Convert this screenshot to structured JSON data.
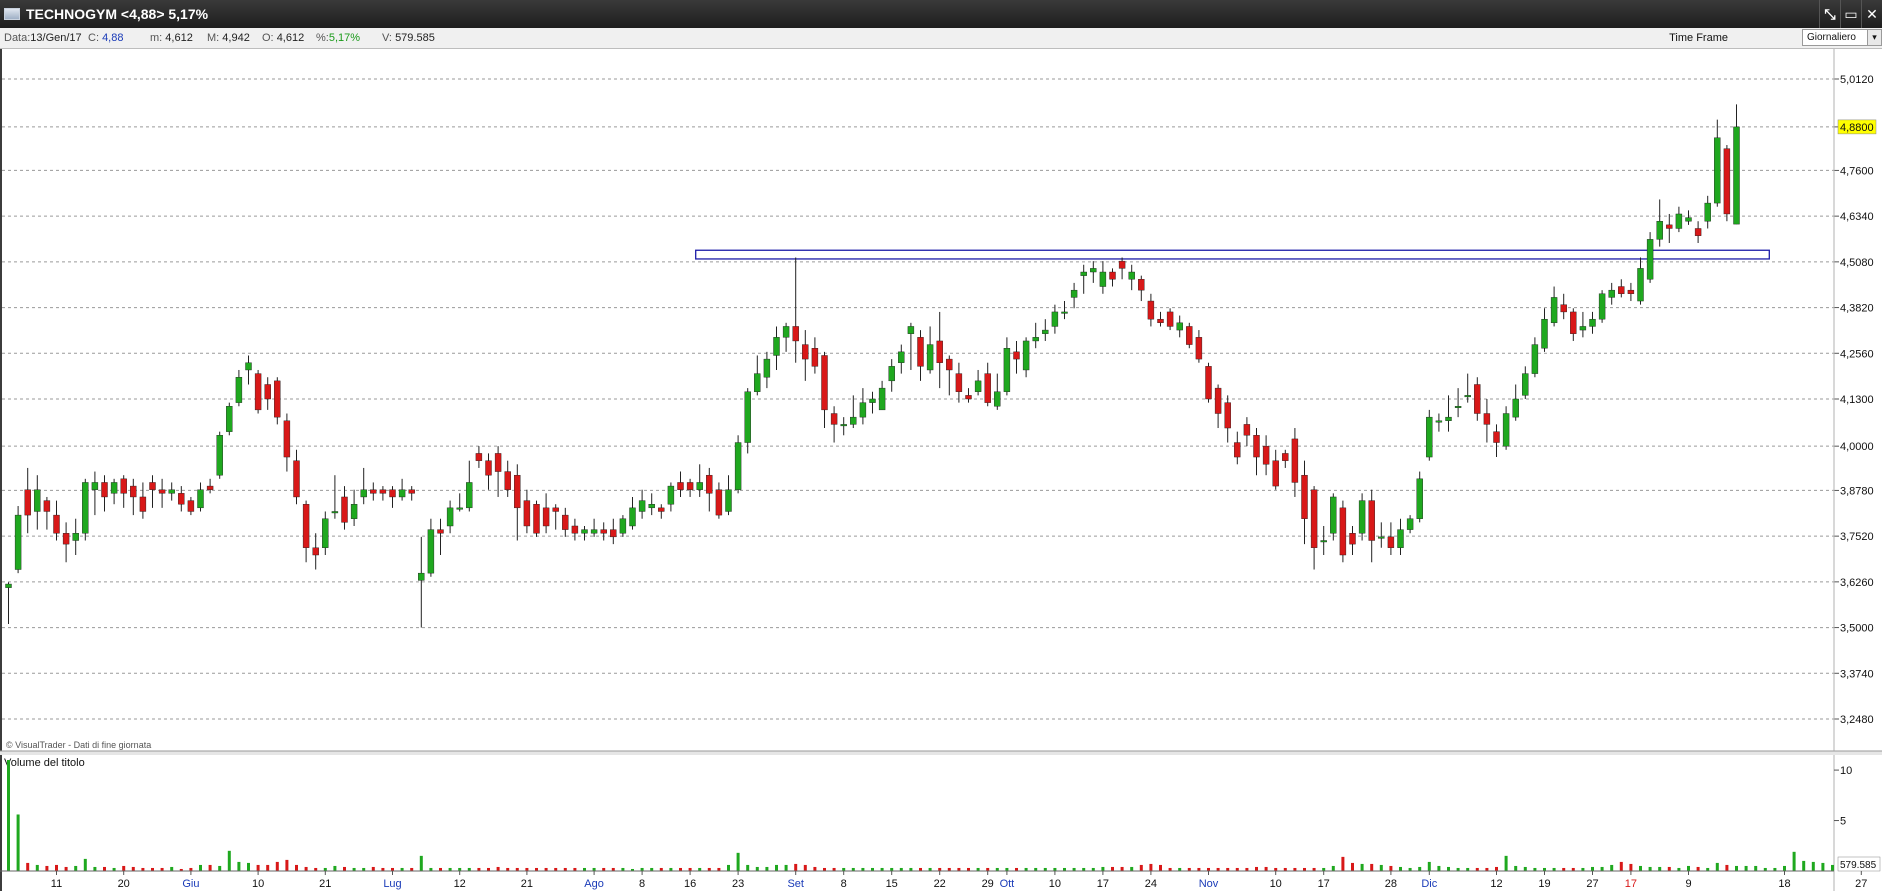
{
  "window": {
    "title": "TECHNOGYM <4,88> 5,17%",
    "controls": [
      "⤡",
      "▭",
      "✕"
    ]
  },
  "infobar": {
    "data_label": "Data:",
    "data_value": "13/Gen/17",
    "c_label": "C:",
    "c_value": "4,88",
    "min_label": "m:",
    "min_value": "4,612",
    "max_label": "M:",
    "max_value": "4,942",
    "o_label": "O:",
    "o_value": "4,612",
    "pct_label": "%:",
    "pct_value": "5,17%",
    "v_label": "V:",
    "v_value": "579.585",
    "timeframe_label": "Time Frame",
    "timeframe_value": "Giornaliero"
  },
  "colors": {
    "up": "#1fa81f",
    "down": "#d81818",
    "grid": "#9a9a9a",
    "rect": "#1c1ca8",
    "last_price_bg": "#ffff00"
  },
  "chart_data": {
    "type": "candlestick",
    "price_axis": {
      "ticks": [
        "5,0120",
        "4,8800",
        "4,7600",
        "4,6340",
        "4,5080",
        "4,3820",
        "4,2560",
        "4,1300",
        "4,0000",
        "3,8780",
        "3,7520",
        "3,6260",
        "3,5000",
        "3,3740",
        "3,2480"
      ],
      "ylim": [
        3.2,
        5.06
      ],
      "last_price": "4,8800"
    },
    "x_axis_labels": [
      {
        "label": "11",
        "idx": 5,
        "month": false
      },
      {
        "label": "20",
        "idx": 12,
        "month": false
      },
      {
        "label": "Giu",
        "idx": 19,
        "month": true
      },
      {
        "label": "10",
        "idx": 26,
        "month": false
      },
      {
        "label": "21",
        "idx": 33,
        "month": false
      },
      {
        "label": "Lug",
        "idx": 40,
        "month": true
      },
      {
        "label": "12",
        "idx": 47,
        "month": false
      },
      {
        "label": "21",
        "idx": 54,
        "month": false
      },
      {
        "label": "Ago",
        "idx": 61,
        "month": true
      },
      {
        "label": "8",
        "idx": 66,
        "month": false
      },
      {
        "label": "16",
        "idx": 71,
        "month": false
      },
      {
        "label": "23",
        "idx": 76,
        "month": false
      },
      {
        "label": "Set",
        "idx": 82,
        "month": true
      },
      {
        "label": "8",
        "idx": 87,
        "month": false
      },
      {
        "label": "15",
        "idx": 92,
        "month": false
      },
      {
        "label": "22",
        "idx": 97,
        "month": false
      },
      {
        "label": "29",
        "idx": 102,
        "month": false
      },
      {
        "label": "Ott",
        "idx": 104,
        "month": true
      },
      {
        "label": "10",
        "idx": 109,
        "month": false
      },
      {
        "label": "17",
        "idx": 114,
        "month": false
      },
      {
        "label": "24",
        "idx": 119,
        "month": false
      },
      {
        "label": "Nov",
        "idx": 125,
        "month": true
      },
      {
        "label": "10",
        "idx": 132,
        "month": false
      },
      {
        "label": "17",
        "idx": 137,
        "month": false
      },
      {
        "label": "28",
        "idx": 144,
        "month": false
      },
      {
        "label": "Dic",
        "idx": 148,
        "month": true
      },
      {
        "label": "12",
        "idx": 155,
        "month": false
      },
      {
        "label": "19",
        "idx": 160,
        "month": false
      },
      {
        "label": "27",
        "idx": 165,
        "month": false
      },
      {
        "label": "17",
        "idx": 169,
        "month": true
      },
      {
        "label": "9",
        "idx": 175,
        "month": false
      },
      {
        "label": "18",
        "idx": 185,
        "month": false
      },
      {
        "label": "27",
        "idx": 193,
        "month": false
      }
    ],
    "horizontal_level": {
      "price": 4.54,
      "low": 4.516,
      "from_idx": 72,
      "to_idx": 183
    },
    "candles": [
      [
        3.61,
        3.62,
        3.51,
        3.625
      ],
      [
        3.66,
        3.81,
        3.65,
        3.835
      ],
      [
        3.88,
        3.81,
        3.76,
        3.94
      ],
      [
        3.82,
        3.88,
        3.77,
        3.92
      ],
      [
        3.85,
        3.82,
        3.77,
        3.86
      ],
      [
        3.81,
        3.76,
        3.74,
        3.85
      ],
      [
        3.76,
        3.73,
        3.68,
        3.79
      ],
      [
        3.74,
        3.76,
        3.7,
        3.8
      ],
      [
        3.76,
        3.9,
        3.74,
        3.91
      ],
      [
        3.88,
        3.9,
        3.81,
        3.93
      ],
      [
        3.9,
        3.86,
        3.82,
        3.92
      ],
      [
        3.87,
        3.9,
        3.84,
        3.91
      ],
      [
        3.91,
        3.87,
        3.83,
        3.92
      ],
      [
        3.89,
        3.86,
        3.81,
        3.91
      ],
      [
        3.86,
        3.82,
        3.8,
        3.9
      ],
      [
        3.9,
        3.88,
        3.83,
        3.92
      ],
      [
        3.88,
        3.87,
        3.83,
        3.91
      ],
      [
        3.87,
        3.88,
        3.85,
        3.9
      ],
      [
        3.87,
        3.84,
        3.82,
        3.89
      ],
      [
        3.85,
        3.82,
        3.81,
        3.86
      ],
      [
        3.83,
        3.88,
        3.82,
        3.9
      ],
      [
        3.89,
        3.88,
        3.87,
        3.91
      ],
      [
        3.92,
        4.03,
        3.91,
        4.04
      ],
      [
        4.04,
        4.11,
        4.03,
        4.12
      ],
      [
        4.12,
        4.19,
        4.11,
        4.21
      ],
      [
        4.21,
        4.23,
        4.17,
        4.25
      ],
      [
        4.2,
        4.1,
        4.09,
        4.21
      ],
      [
        4.17,
        4.13,
        4.1,
        4.19
      ],
      [
        4.18,
        4.08,
        4.06,
        4.19
      ],
      [
        4.07,
        3.97,
        3.93,
        4.09
      ],
      [
        3.96,
        3.86,
        3.84,
        3.99
      ],
      [
        3.84,
        3.72,
        3.68,
        3.85
      ],
      [
        3.72,
        3.7,
        3.66,
        3.76
      ],
      [
        3.72,
        3.8,
        3.7,
        3.82
      ],
      [
        3.82,
        3.82,
        3.8,
        3.92
      ],
      [
        3.86,
        3.79,
        3.77,
        3.89
      ],
      [
        3.8,
        3.84,
        3.78,
        3.88
      ],
      [
        3.86,
        3.88,
        3.84,
        3.94
      ],
      [
        3.88,
        3.87,
        3.85,
        3.9
      ],
      [
        3.88,
        3.87,
        3.85,
        3.89
      ],
      [
        3.88,
        3.86,
        3.83,
        3.89
      ],
      [
        3.86,
        3.88,
        3.85,
        3.91
      ],
      [
        3.88,
        3.87,
        3.85,
        3.89
      ],
      [
        3.63,
        3.65,
        3.5,
        3.75
      ],
      [
        3.65,
        3.77,
        3.64,
        3.8
      ],
      [
        3.77,
        3.76,
        3.7,
        3.8
      ],
      [
        3.78,
        3.83,
        3.76,
        3.85
      ],
      [
        3.83,
        3.83,
        3.82,
        3.87
      ],
      [
        3.83,
        3.9,
        3.82,
        3.96
      ],
      [
        3.98,
        3.96,
        3.94,
        4.0
      ],
      [
        3.96,
        3.92,
        3.88,
        3.98
      ],
      [
        3.98,
        3.93,
        3.86,
        4.0
      ],
      [
        3.93,
        3.88,
        3.86,
        3.96
      ],
      [
        3.92,
        3.83,
        3.74,
        3.95
      ],
      [
        3.85,
        3.78,
        3.76,
        3.88
      ],
      [
        3.84,
        3.76,
        3.75,
        3.85
      ],
      [
        3.83,
        3.78,
        3.76,
        3.87
      ],
      [
        3.83,
        3.82,
        3.77,
        3.84
      ],
      [
        3.81,
        3.77,
        3.75,
        3.83
      ],
      [
        3.78,
        3.76,
        3.74,
        3.8
      ],
      [
        3.76,
        3.77,
        3.74,
        3.78
      ],
      [
        3.76,
        3.77,
        3.75,
        3.8
      ],
      [
        3.77,
        3.76,
        3.74,
        3.79
      ],
      [
        3.77,
        3.75,
        3.73,
        3.8
      ],
      [
        3.76,
        3.8,
        3.75,
        3.81
      ],
      [
        3.78,
        3.83,
        3.77,
        3.86
      ],
      [
        3.82,
        3.85,
        3.8,
        3.88
      ],
      [
        3.83,
        3.84,
        3.81,
        3.87
      ],
      [
        3.83,
        3.82,
        3.8,
        3.84
      ],
      [
        3.84,
        3.89,
        3.82,
        3.9
      ],
      [
        3.9,
        3.88,
        3.86,
        3.93
      ],
      [
        3.9,
        3.88,
        3.86,
        3.91
      ],
      [
        3.88,
        3.9,
        3.86,
        3.95
      ],
      [
        3.92,
        3.87,
        3.82,
        3.94
      ],
      [
        3.88,
        3.81,
        3.8,
        3.9
      ],
      [
        3.82,
        3.88,
        3.81,
        3.92
      ],
      [
        3.88,
        4.01,
        3.87,
        4.03
      ],
      [
        4.01,
        4.15,
        3.98,
        4.16
      ],
      [
        4.15,
        4.2,
        4.14,
        4.25
      ],
      [
        4.19,
        4.24,
        4.16,
        4.26
      ],
      [
        4.25,
        4.3,
        4.21,
        4.33
      ],
      [
        4.3,
        4.33,
        4.26,
        4.34
      ],
      [
        4.33,
        4.29,
        4.23,
        4.52
      ],
      [
        4.28,
        4.24,
        4.18,
        4.32
      ],
      [
        4.27,
        4.22,
        4.2,
        4.3
      ],
      [
        4.25,
        4.1,
        4.05,
        4.26
      ],
      [
        4.09,
        4.06,
        4.01,
        4.11
      ],
      [
        4.06,
        4.06,
        4.03,
        4.08
      ],
      [
        4.06,
        4.08,
        4.05,
        4.14
      ],
      [
        4.08,
        4.12,
        4.06,
        4.16
      ],
      [
        4.12,
        4.13,
        4.09,
        4.15
      ],
      [
        4.1,
        4.16,
        4.1,
        4.18
      ],
      [
        4.18,
        4.22,
        4.15,
        4.24
      ],
      [
        4.23,
        4.26,
        4.2,
        4.28
      ],
      [
        4.31,
        4.33,
        4.21,
        4.34
      ],
      [
        4.3,
        4.22,
        4.18,
        4.32
      ],
      [
        4.21,
        4.28,
        4.2,
        4.33
      ],
      [
        4.29,
        4.23,
        4.16,
        4.37
      ],
      [
        4.24,
        4.21,
        4.14,
        4.25
      ],
      [
        4.2,
        4.15,
        4.12,
        4.23
      ],
      [
        4.14,
        4.13,
        4.12,
        4.16
      ],
      [
        4.15,
        4.18,
        4.14,
        4.21
      ],
      [
        4.2,
        4.12,
        4.11,
        4.23
      ],
      [
        4.11,
        4.15,
        4.1,
        4.2
      ],
      [
        4.15,
        4.27,
        4.14,
        4.3
      ],
      [
        4.26,
        4.24,
        4.2,
        4.29
      ],
      [
        4.21,
        4.29,
        4.19,
        4.3
      ],
      [
        4.29,
        4.3,
        4.27,
        4.34
      ],
      [
        4.31,
        4.32,
        4.29,
        4.35
      ],
      [
        4.33,
        4.37,
        4.31,
        4.39
      ],
      [
        4.37,
        4.37,
        4.35,
        4.4
      ],
      [
        4.41,
        4.43,
        4.38,
        4.45
      ],
      [
        4.47,
        4.48,
        4.42,
        4.5
      ],
      [
        4.48,
        4.49,
        4.45,
        4.51
      ],
      [
        4.44,
        4.48,
        4.42,
        4.51
      ],
      [
        4.48,
        4.46,
        4.44,
        4.49
      ],
      [
        4.51,
        4.49,
        4.46,
        4.52
      ],
      [
        4.46,
        4.48,
        4.43,
        4.5
      ],
      [
        4.46,
        4.43,
        4.4,
        4.47
      ],
      [
        4.4,
        4.35,
        4.33,
        4.42
      ],
      [
        4.35,
        4.34,
        4.33,
        4.37
      ],
      [
        4.37,
        4.33,
        4.32,
        4.38
      ],
      [
        4.32,
        4.34,
        4.3,
        4.36
      ],
      [
        4.33,
        4.28,
        4.27,
        4.34
      ],
      [
        4.3,
        4.24,
        4.23,
        4.32
      ],
      [
        4.22,
        4.13,
        4.12,
        4.23
      ],
      [
        4.16,
        4.09,
        4.05,
        4.17
      ],
      [
        4.12,
        4.05,
        4.01,
        4.14
      ],
      [
        4.01,
        3.97,
        3.95,
        4.04
      ],
      [
        4.06,
        4.03,
        4.0,
        4.08
      ],
      [
        4.03,
        3.97,
        3.92,
        4.05
      ],
      [
        4.0,
        3.95,
        3.92,
        4.03
      ],
      [
        3.96,
        3.89,
        3.88,
        3.99
      ],
      [
        3.98,
        3.96,
        3.94,
        3.99
      ],
      [
        4.02,
        3.9,
        3.86,
        4.05
      ],
      [
        3.92,
        3.8,
        3.73,
        3.96
      ],
      [
        3.88,
        3.72,
        3.66,
        3.89
      ],
      [
        3.74,
        3.74,
        3.7,
        3.78
      ],
      [
        3.76,
        3.86,
        3.74,
        3.87
      ],
      [
        3.83,
        3.7,
        3.68,
        3.85
      ],
      [
        3.76,
        3.73,
        3.7,
        3.78
      ],
      [
        3.76,
        3.85,
        3.74,
        3.87
      ],
      [
        3.85,
        3.74,
        3.68,
        3.88
      ],
      [
        3.75,
        3.75,
        3.72,
        3.79
      ],
      [
        3.75,
        3.72,
        3.7,
        3.79
      ],
      [
        3.72,
        3.77,
        3.7,
        3.8
      ],
      [
        3.77,
        3.8,
        3.76,
        3.81
      ],
      [
        3.8,
        3.91,
        3.79,
        3.93
      ],
      [
        3.97,
        4.08,
        3.96,
        4.1
      ],
      [
        4.07,
        4.07,
        4.04,
        4.09
      ],
      [
        4.07,
        4.08,
        4.04,
        4.14
      ],
      [
        4.11,
        4.11,
        4.08,
        4.16
      ],
      [
        4.14,
        4.14,
        4.12,
        4.2
      ],
      [
        4.17,
        4.09,
        4.07,
        4.19
      ],
      [
        4.09,
        4.06,
        4.01,
        4.13
      ],
      [
        4.04,
        4.01,
        3.97,
        4.06
      ],
      [
        4.0,
        4.09,
        3.99,
        4.11
      ],
      [
        4.08,
        4.13,
        4.07,
        4.17
      ],
      [
        4.14,
        4.2,
        4.13,
        4.22
      ],
      [
        4.2,
        4.28,
        4.19,
        4.3
      ],
      [
        4.27,
        4.35,
        4.26,
        4.38
      ],
      [
        4.34,
        4.41,
        4.33,
        4.44
      ],
      [
        4.39,
        4.37,
        4.35,
        4.42
      ],
      [
        4.37,
        4.31,
        4.29,
        4.38
      ],
      [
        4.32,
        4.33,
        4.3,
        4.37
      ],
      [
        4.33,
        4.35,
        4.31,
        4.37
      ],
      [
        4.35,
        4.42,
        4.34,
        4.43
      ],
      [
        4.41,
        4.43,
        4.39,
        4.45
      ],
      [
        4.44,
        4.42,
        4.41,
        4.46
      ],
      [
        4.43,
        4.42,
        4.4,
        4.45
      ],
      [
        4.4,
        4.49,
        4.39,
        4.52
      ],
      [
        4.46,
        4.57,
        4.45,
        4.59
      ],
      [
        4.57,
        4.62,
        4.55,
        4.68
      ],
      [
        4.61,
        4.6,
        4.56,
        4.64
      ],
      [
        4.6,
        4.64,
        4.59,
        4.66
      ],
      [
        4.62,
        4.63,
        4.61,
        4.65
      ],
      [
        4.6,
        4.58,
        4.56,
        4.62
      ],
      [
        4.62,
        4.67,
        4.6,
        4.69
      ],
      [
        4.67,
        4.85,
        4.66,
        4.9
      ],
      [
        4.82,
        4.64,
        4.62,
        4.83
      ],
      [
        4.612,
        4.88,
        4.612,
        4.942
      ]
    ],
    "volume_panel": {
      "title": "Volume del titolo",
      "ticks": [
        "10",
        "5"
      ],
      "ymax": 11.0,
      "last_volume": "579.585",
      "values": [
        11.0,
        5.6,
        0.8,
        0.6,
        0.5,
        0.6,
        0.4,
        0.5,
        1.2,
        0.4,
        0.4,
        0.3,
        0.5,
        0.4,
        0.3,
        0.3,
        0.3,
        0.4,
        0.2,
        0.3,
        0.6,
        0.6,
        0.5,
        2.0,
        0.9,
        0.8,
        0.6,
        0.6,
        0.9,
        1.1,
        0.6,
        0.4,
        0.3,
        0.3,
        0.5,
        0.4,
        0.3,
        0.3,
        0.4,
        0.3,
        0.3,
        0.3,
        0.3,
        1.5,
        0.3,
        0.3,
        0.3,
        0.3,
        0.3,
        0.3,
        0.3,
        0.4,
        0.3,
        0.3,
        0.3,
        0.3,
        0.3,
        0.3,
        0.3,
        0.3,
        0.3,
        0.3,
        0.3,
        0.3,
        0.3,
        0.2,
        0.3,
        0.3,
        0.3,
        0.3,
        0.3,
        0.3,
        0.3,
        0.3,
        0.3,
        0.6,
        1.8,
        0.6,
        0.4,
        0.4,
        0.6,
        0.6,
        0.7,
        0.6,
        0.4,
        0.3,
        0.3,
        0.3,
        0.3,
        0.3,
        0.3,
        0.3,
        0.3,
        0.3,
        0.3,
        0.3,
        0.3,
        0.3,
        0.3,
        0.3,
        0.3,
        0.3,
        0.3,
        0.3,
        0.3,
        0.3,
        0.3,
        0.3,
        0.3,
        0.3,
        0.3,
        0.3,
        0.3,
        0.3,
        0.4,
        0.4,
        0.4,
        0.4,
        0.6,
        0.7,
        0.6,
        0.3,
        0.3,
        0.3,
        0.3,
        0.3,
        0.3,
        0.3,
        0.3,
        0.3,
        0.4,
        0.4,
        0.3,
        0.3,
        0.3,
        0.3,
        0.3,
        0.3,
        0.5,
        1.4,
        0.8,
        0.7,
        0.7,
        0.6,
        0.5,
        0.4,
        0.3,
        0.4,
        0.9,
        0.5,
        0.4,
        0.3,
        0.3,
        0.3,
        0.3,
        0.4,
        1.5,
        0.5,
        0.4,
        0.3,
        0.3,
        0.3,
        0.3,
        0.3,
        0.3,
        0.4,
        0.4,
        0.6,
        0.9,
        0.7,
        0.5,
        0.4,
        0.4,
        0.4,
        0.3,
        0.5,
        0.4,
        0.3,
        0.8,
        0.6,
        0.5,
        0.5,
        0.5,
        0.3,
        0.3,
        0.5,
        1.9,
        1.0,
        0.9,
        0.8,
        0.6
      ]
    }
  },
  "watermark": "© VisualTrader - Dati di fine giornata"
}
